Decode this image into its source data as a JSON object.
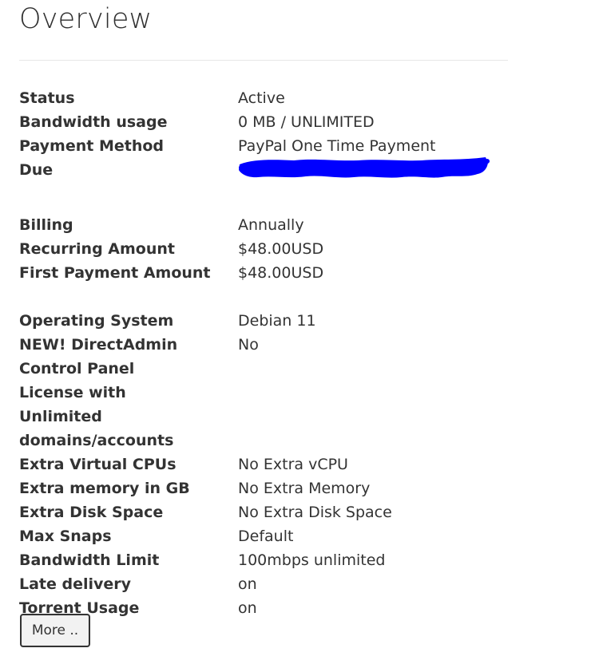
{
  "page": {
    "title": "Overview"
  },
  "groups": [
    [
      {
        "label": "Status",
        "value": "Active"
      },
      {
        "label": "Bandwidth usage",
        "value": "0 MB / UNLIMITED"
      },
      {
        "label": "Payment Method",
        "value": "PayPal One Time Payment"
      },
      {
        "label": "Due",
        "value": ""
      }
    ],
    [
      {
        "label": "Billing",
        "value": "Annually"
      },
      {
        "label": "Recurring Amount",
        "value": "$48.00USD"
      },
      {
        "label": "First Payment Amount",
        "value": "$48.00USD"
      }
    ],
    [
      {
        "label": "Operating System",
        "value": "Debian 11"
      },
      {
        "label": "NEW! DirectAdmin Control Panel License with Unlimited domains/accounts",
        "value": "No"
      },
      {
        "label": "Extra Virtual CPUs",
        "value": "No Extra vCPU"
      },
      {
        "label": "Extra memory in GB",
        "value": "No Extra Memory"
      },
      {
        "label": "Extra Disk Space",
        "value": "No Extra Disk Space"
      },
      {
        "label": "Max Snaps",
        "value": "Default"
      },
      {
        "label": "Bandwidth Limit",
        "value": "100mbps unlimited"
      },
      {
        "label": "Late delivery",
        "value": "on"
      },
      {
        "label": "Torrent Usage",
        "value": "on"
      }
    ]
  ],
  "actions": {
    "more_label": "More .."
  },
  "colors": {
    "redaction": "#0000ff",
    "text": "#333333"
  }
}
